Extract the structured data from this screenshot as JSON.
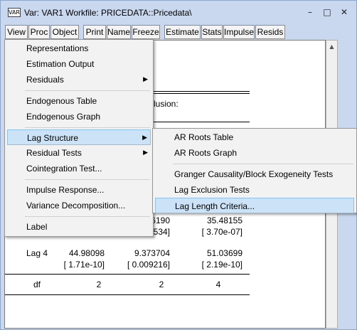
{
  "window": {
    "app_icon_text": "VAR",
    "title": "Var: VAR1   Workfile: PRICEDATA::Pricedata\\",
    "minimize_glyph": "–",
    "maximize_glyph": "□",
    "close_glyph": "✕"
  },
  "toolbar": [
    "View",
    "Proc",
    "Object",
    "Print",
    "Name",
    "Freeze",
    "Estimate",
    "Stats",
    "Impulse",
    "Resids"
  ],
  "content": {
    "partial_text": "lusion:",
    "cell_36190": "36190",
    "cell_35": "35.48155",
    "cell_27534": "27534]",
    "cell_370": "[ 3.70e-07]",
    "lag4_label": "Lag 4",
    "lag4_v1": "44.98098",
    "lag4_v2": "9.373704",
    "lag4_v3": "51.03699",
    "lag4_p1": "[ 1.71e-10]",
    "lag4_p2": "[ 0.009216]",
    "lag4_p3": "[ 2.19e-10]",
    "df_label": "df",
    "df_v1": "2",
    "df_v2": "2",
    "df_v3": "4"
  },
  "view_menu": [
    "Representations",
    "Estimation Output",
    "Residuals",
    "Endogenous Table",
    "Endogenous Graph",
    "Lag Structure",
    "Residual Tests",
    "Cointegration Test...",
    "Impulse Response...",
    "Variance Decomposition...",
    "Label"
  ],
  "lag_structure_menu": [
    "AR Roots Table",
    "AR Roots Graph",
    "Granger Causality/Block Exogeneity Tests",
    "Lag Exclusion Tests",
    "Lag Length Criteria..."
  ],
  "colors": {
    "titlebar": "#c9d8ef",
    "menu_bg": "#f2f2f2",
    "highlight": "#cce3f7",
    "highlight_border": "#90c0e8"
  }
}
